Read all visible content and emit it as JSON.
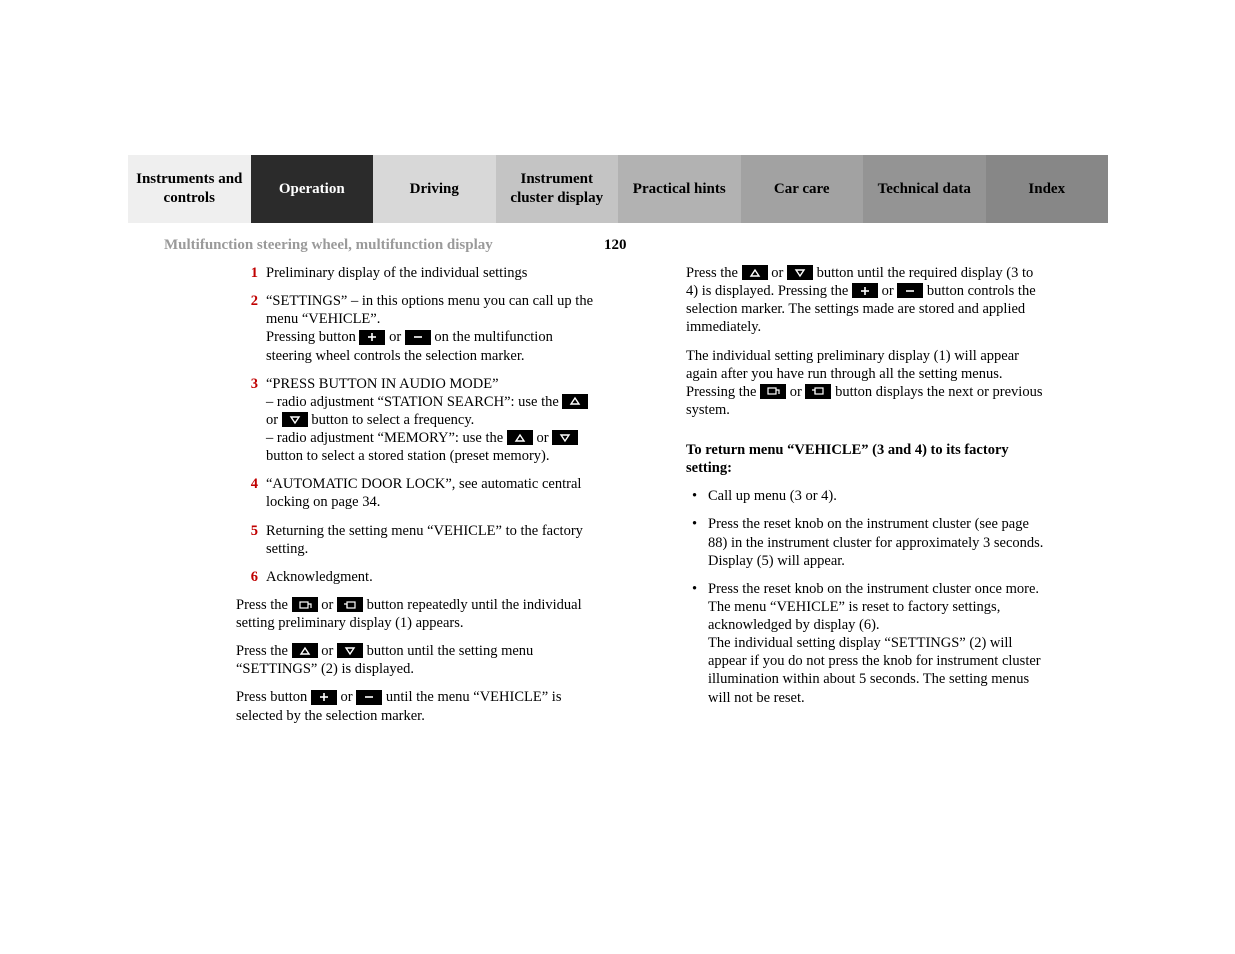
{
  "tabs": [
    {
      "label": "Instruments and controls",
      "bg": "#efefef",
      "fg": "#000"
    },
    {
      "label": "Operation",
      "bg": "#2b2b2b",
      "fg": "#fff"
    },
    {
      "label": "Driving",
      "bg": "#d8d8d8",
      "fg": "#000"
    },
    {
      "label": "Instrument cluster display",
      "bg": "#c4c4c4",
      "fg": "#000"
    },
    {
      "label": "Practical hints",
      "bg": "#b2b2b2",
      "fg": "#000"
    },
    {
      "label": "Car care",
      "bg": "#a2a2a2",
      "fg": "#000"
    },
    {
      "label": "Technical data",
      "bg": "#949494",
      "fg": "#000"
    },
    {
      "label": "Index",
      "bg": "#878787",
      "fg": "#000"
    }
  ],
  "header": {
    "section_title": "Multifunction steering wheel, multifunction display",
    "page_number": "120"
  },
  "list": {
    "i1": "Preliminary display of the individual settings",
    "i2a": "“SETTINGS” – in this options menu you can call up the menu “VEHICLE”.",
    "i2b_pre": "Pressing button ",
    "i2b_mid": " or ",
    "i2b_post": " on the multifunction steering wheel controls the selection marker.",
    "i3a": "“PRESS BUTTON IN AUDIO MODE”",
    "i3b_pre": "– radio adjustment “STATION SEARCH”: use the ",
    "i3b_mid": " or ",
    "i3b_post": " button to select a frequency.",
    "i3c_pre": "– radio adjustment “MEMORY”: use the ",
    "i3c_mid": " or ",
    "i3c_post": " button to select a stored station (preset memory).",
    "i4": "“AUTOMATIC DOOR LOCK”, see automatic central locking on page 34.",
    "i5": "Returning the setting menu “VEHICLE” to the factory setting.",
    "i6": "Acknowledgment."
  },
  "left_paras": {
    "p1_pre": "Press the ",
    "p1_mid": " or ",
    "p1_post": " button repeatedly until the individual setting preliminary display (1) appears.",
    "p2_pre": "Press the ",
    "p2_mid": " or ",
    "p2_post": " button until the setting menu “SETTINGS” (2) is displayed.",
    "p3_pre": "Press button ",
    "p3_mid": " or ",
    "p3_post": " until the menu “VEHICLE” is selected by the selection marker."
  },
  "right_paras": {
    "p1_pre": "Press the ",
    "p1_mid1": " or ",
    "p1_mid2": " button until the required display (3 to 4) is displayed. Pressing the ",
    "p1_mid3": " or ",
    "p1_post": " button controls the selection marker. The settings made are stored and applied immediately.",
    "p2_pre": "The individual setting preliminary display (1) will appear again after you have run through all the setting menus. Pressing the ",
    "p2_mid": " or ",
    "p2_post": " button displays the next or previous system.",
    "heading": "To return menu “VEHICLE” (3 and 4) to its factory setting:",
    "b1": "Call up menu (3 or 4).",
    "b2": "Press the reset knob on the instrument cluster (see page 88) in the instrument cluster for approximately 3 seconds. Display (5) will appear.",
    "b3a": "Press the reset knob on the instrument cluster once more. The menu “VEHICLE”  is reset to factory settings, acknowledged by display (6).",
    "b3b": "The individual setting display “SETTINGS” (2) will appear if you do not press the knob for instrument cluster illumination within about 5 seconds. The setting menus will not be reset."
  },
  "nums": {
    "n1": "1",
    "n2": "2",
    "n3": "3",
    "n4": "4",
    "n5": "5",
    "n6": "6"
  }
}
